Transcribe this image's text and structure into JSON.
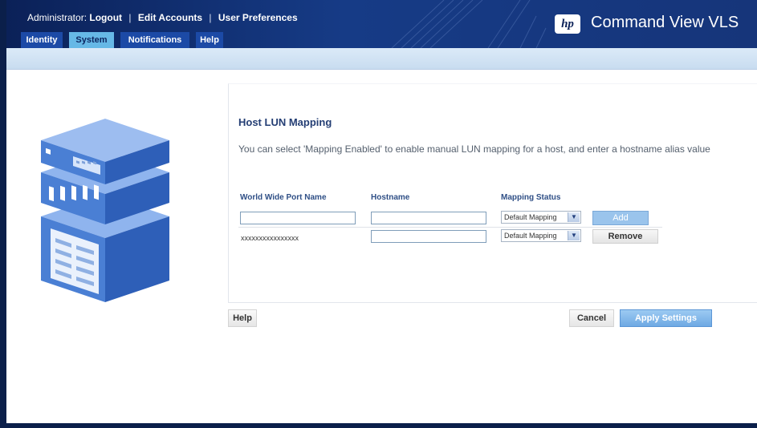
{
  "header": {
    "admin_label": "Administrator:",
    "links": [
      "Logout",
      "Edit Accounts",
      "User Preferences"
    ],
    "separator": "|",
    "product_title": "Command View VLS",
    "logo_text": "hp"
  },
  "tabs": [
    {
      "label": "Identity",
      "active": false
    },
    {
      "label": "System",
      "active": true
    },
    {
      "label": "Notifications",
      "active": false
    },
    {
      "label": "Help",
      "active": false
    }
  ],
  "main": {
    "title": "Host LUN Mapping",
    "description": "You can select 'Mapping Enabled' to enable manual LUN mapping for a host, and enter a hostname alias value",
    "columns": [
      "World Wide Port Name",
      "Hostname",
      "Mapping Status"
    ],
    "rows": [
      {
        "wwpn": "",
        "hostname": "",
        "mapping_status": "Default Mapping",
        "action": "Add"
      },
      {
        "wwpn": "xxxxxxxxxxxxxxxx",
        "hostname": "",
        "mapping_status": "Default Mapping",
        "action": "Remove"
      }
    ]
  },
  "footer": {
    "help_label": "Help",
    "cancel_label": "Cancel",
    "apply_label": "Apply Settings"
  },
  "colors": {
    "header_navy": "#0b2158",
    "tab_blue": "#1c4aa6",
    "tab_active": "#66b8e6",
    "accent_blue": "#6ea9e3",
    "server_blue": "#3f72c9"
  },
  "icons": [
    "server-illustration-icon",
    "hp-logo",
    "dropdown-arrow-icon"
  ]
}
